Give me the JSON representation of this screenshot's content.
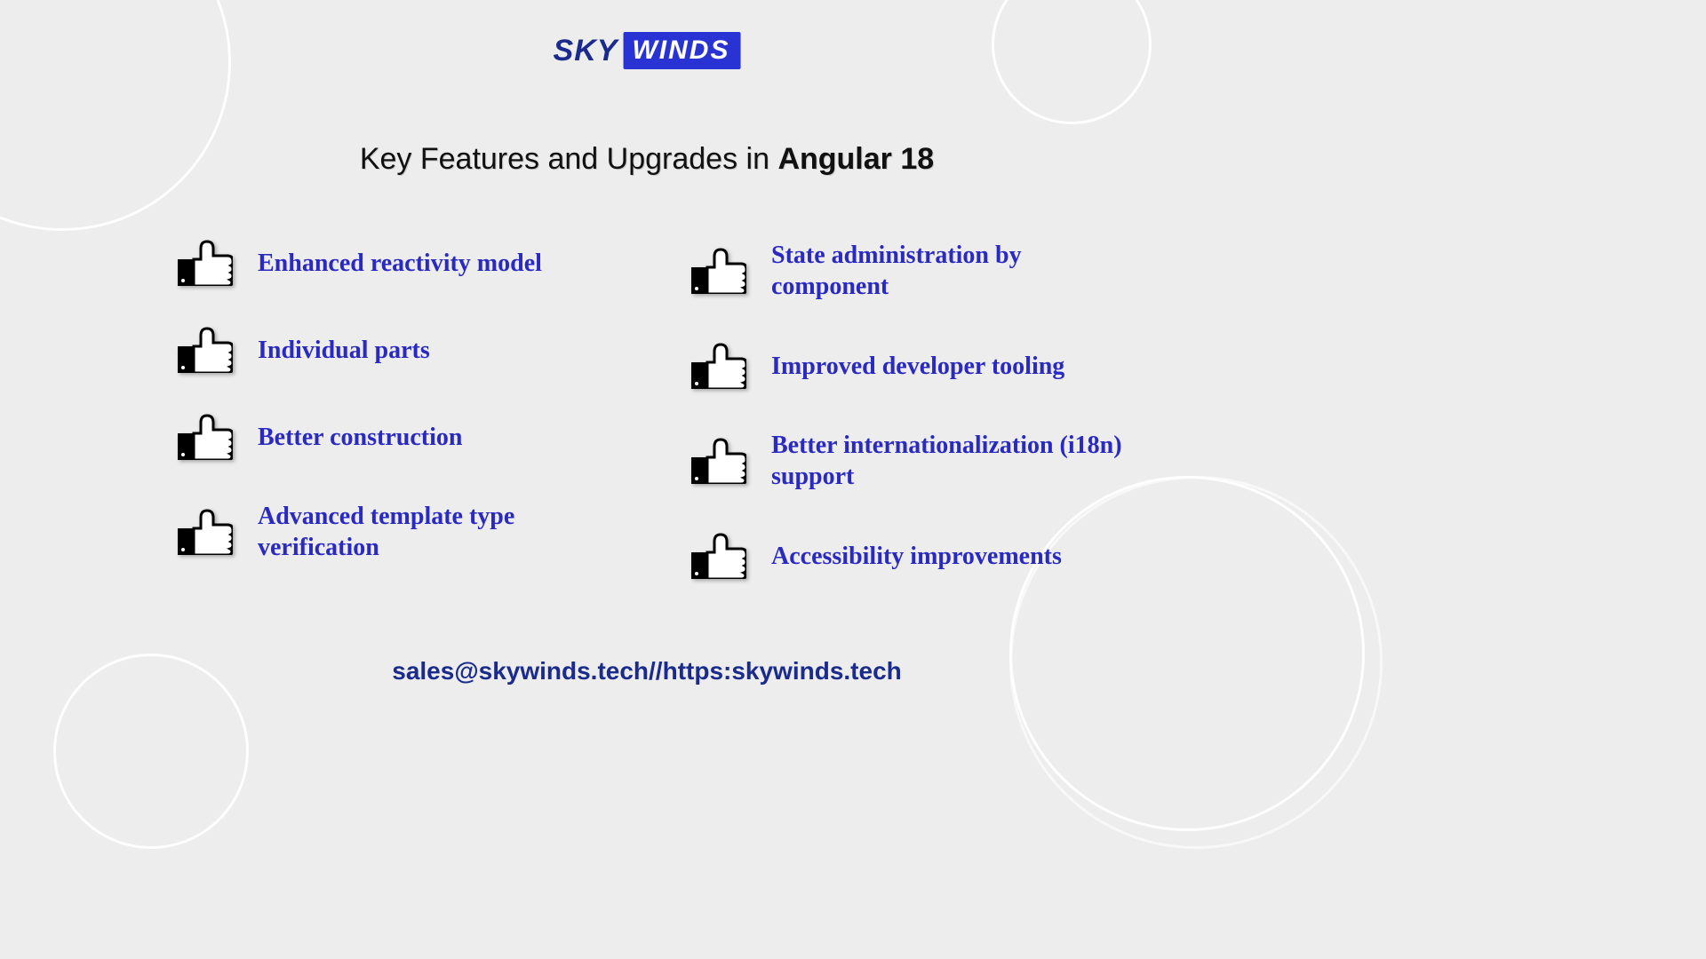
{
  "logo": {
    "part1": "SKY",
    "part2": "WINDS"
  },
  "title": {
    "pre": "Key Features and Upgrades in ",
    "bold": "Angular 18"
  },
  "features_left": [
    "Enhanced reactivity model",
    "Individual parts",
    "Better construction",
    "Advanced template type verification"
  ],
  "features_right": [
    "State administration by component",
    "Improved developer tooling",
    "Better internationalization (i18n) support",
    "Accessibility improvements"
  ],
  "footer": "sales@skywinds.tech//https:skywinds.tech"
}
